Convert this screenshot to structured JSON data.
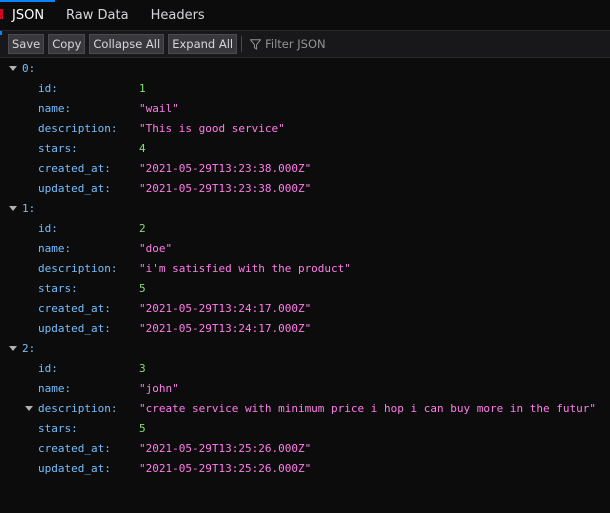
{
  "tabs": [
    {
      "label": "JSON",
      "selected": true
    },
    {
      "label": "Raw Data",
      "selected": false
    },
    {
      "label": "Headers",
      "selected": false
    }
  ],
  "toolbar": {
    "save": "Save",
    "copy": "Copy",
    "collapse_all": "Collapse All",
    "expand_all": "Expand All",
    "filter_placeholder": "Filter JSON"
  },
  "colors": {
    "key": "#75bfff",
    "number": "#86de74",
    "string": "#ff7de9",
    "accent": "#0a84ff"
  },
  "records": [
    {
      "index": "0:",
      "fields": [
        {
          "key": "id:",
          "value": "1",
          "type": "number"
        },
        {
          "key": "name:",
          "value": "\"wail\"",
          "type": "string"
        },
        {
          "key": "description:",
          "value": "\"This is good service\"",
          "type": "string"
        },
        {
          "key": "stars:",
          "value": "4",
          "type": "number"
        },
        {
          "key": "created_at:",
          "value": "\"2021-05-29T13:23:38.000Z\"",
          "type": "string"
        },
        {
          "key": "updated_at:",
          "value": "\"2021-05-29T13:23:38.000Z\"",
          "type": "string"
        }
      ]
    },
    {
      "index": "1:",
      "fields": [
        {
          "key": "id:",
          "value": "2",
          "type": "number"
        },
        {
          "key": "name:",
          "value": "\"doe\"",
          "type": "string"
        },
        {
          "key": "description:",
          "value": "\"i'm satisfied with the product\"",
          "type": "string"
        },
        {
          "key": "stars:",
          "value": "5",
          "type": "number"
        },
        {
          "key": "created_at:",
          "value": "\"2021-05-29T13:24:17.000Z\"",
          "type": "string"
        },
        {
          "key": "updated_at:",
          "value": "\"2021-05-29T13:24:17.000Z\"",
          "type": "string"
        }
      ]
    },
    {
      "index": "2:",
      "fields": [
        {
          "key": "id:",
          "value": "3",
          "type": "number"
        },
        {
          "key": "name:",
          "value": "\"john\"",
          "type": "string"
        },
        {
          "key": "description:",
          "value": "\"create service with minimum price i hop i can buy more in the futur\"",
          "type": "string",
          "expandable": true
        },
        {
          "key": "stars:",
          "value": "5",
          "type": "number"
        },
        {
          "key": "created_at:",
          "value": "\"2021-05-29T13:25:26.000Z\"",
          "type": "string"
        },
        {
          "key": "updated_at:",
          "value": "\"2021-05-29T13:25:26.000Z\"",
          "type": "string"
        }
      ]
    }
  ]
}
